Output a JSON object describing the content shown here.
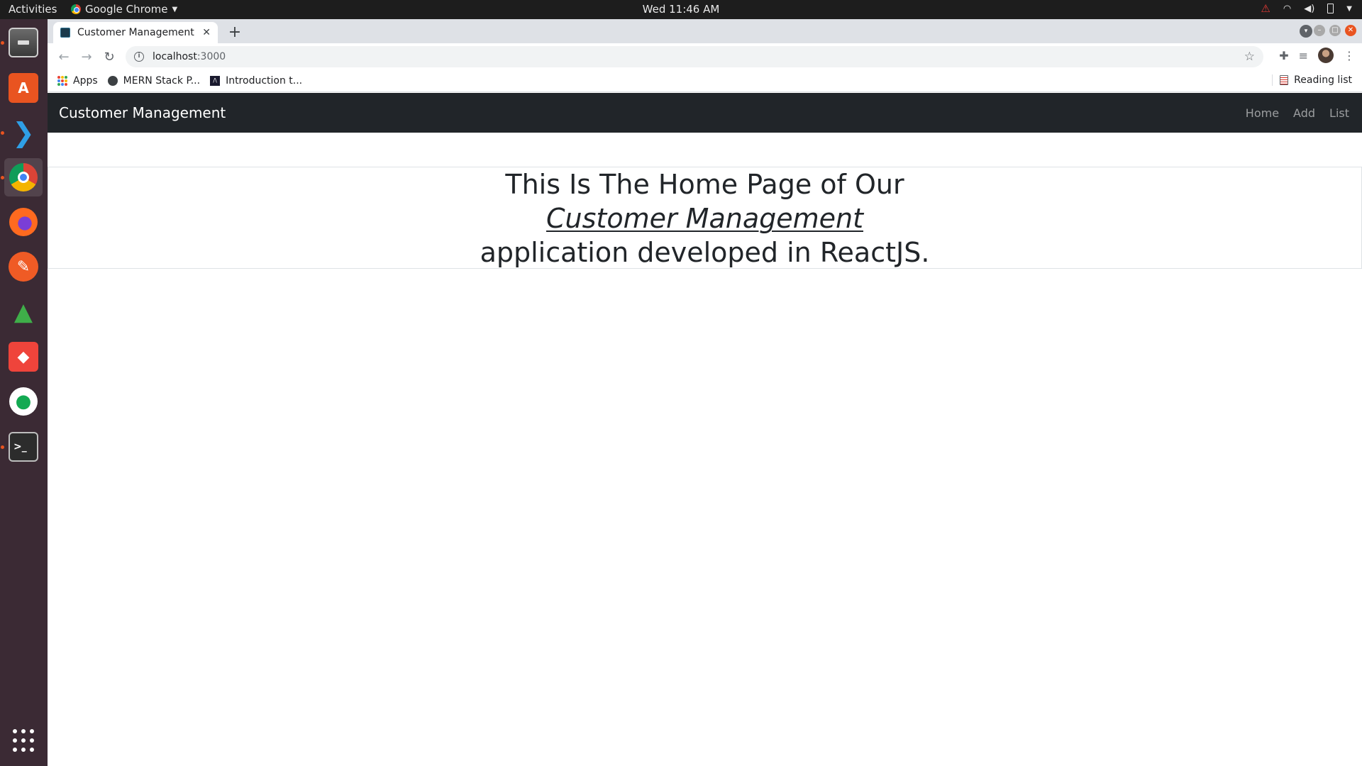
{
  "topbar": {
    "activities": "Activities",
    "app_name": "Google Chrome",
    "clock": "Wed 11:46 AM"
  },
  "dock": {
    "items": [
      {
        "name": "Files"
      },
      {
        "name": "Ubuntu Software"
      },
      {
        "name": "Visual Studio Code"
      },
      {
        "name": "Google Chrome"
      },
      {
        "name": "Firefox"
      },
      {
        "name": "Postman"
      },
      {
        "name": "Robo 3T"
      },
      {
        "name": "AnyDesk"
      },
      {
        "name": "MongoDB Compass"
      },
      {
        "name": "Terminal"
      }
    ]
  },
  "browser": {
    "tab_title": "Customer Management",
    "url_host": "localhost",
    "url_port": ":3000",
    "bookmarks": [
      {
        "label": "Apps"
      },
      {
        "label": "MERN Stack P..."
      },
      {
        "label": "Introduction t..."
      }
    ],
    "reading_list": "Reading list"
  },
  "app": {
    "brand": "Customer Management",
    "nav": [
      "Home",
      "Add",
      "List"
    ],
    "hero": {
      "line1": "This Is The Home Page of Our",
      "line2": "Customer Management",
      "line3": "application developed in ReactJS."
    }
  },
  "colors": {
    "navbar_bg": "#212529",
    "dock_bg": "#3b2a34",
    "ubuntu_accent": "#e95420"
  }
}
